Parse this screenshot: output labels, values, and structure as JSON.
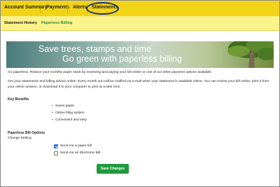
{
  "nav": {
    "items": [
      "Account Summary",
      "Payments",
      "Alerts",
      "Statements"
    ],
    "active": "Statements"
  },
  "subnav": {
    "items": [
      "Statement History",
      "Paperless Billing"
    ]
  },
  "banner": {
    "line1": "Save trees, stamps and time",
    "line2": "Go green with paperless billing"
  },
  "content": {
    "intro": "Go paperless. Reduce your monthly paper stack by reviewing and paying your bill online or one of our other payment options available.",
    "details": "Get your statements and billing advice online. Every month you will be notified via e-mail when your statement is available online. You can review your bill online, print it from your online session, or download it to your computer to print at a later time.",
    "benefits_heading": "Key Benefits",
    "benefits": [
      "Saves paper",
      "Online filing system",
      "Convenient and easy"
    ],
    "options_heading": "Paperless Bill Options",
    "change_setting": "Change Setting",
    "options": [
      {
        "label": "Send me a paper bill",
        "checked": true
      },
      {
        "label": "Send me an Electronic Bill",
        "checked": false
      }
    ],
    "save_label": "Save Changes"
  },
  "colors": {
    "nav_bg": "#f2d416",
    "subnav_bg": "#fcf28a",
    "subnav_active": "#2a8a3a",
    "circle": "#1a2f7a",
    "button": "#1f9a3e",
    "checkbox": "#2f6fd6"
  }
}
